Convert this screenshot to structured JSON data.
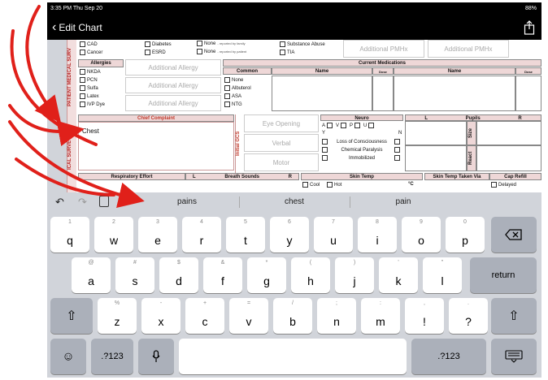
{
  "status": {
    "time_date": "3:35 PM  Thu Sep 20",
    "battery": "88%"
  },
  "nav": {
    "back_label": "Edit Chart"
  },
  "form": {
    "section_patient_history": "PATIENT MEDICAL SURV",
    "section_survey": "ICAL SURVEY",
    "pmh_col1": [
      "CAD",
      "Cancer"
    ],
    "pmh_col2": [
      "Diabetes",
      "ESRD"
    ],
    "pmh_col3": [
      "None",
      "None"
    ],
    "pmh_col3_notes": [
      "- reported by family",
      "- reported by patient"
    ],
    "pmh_col4": [
      "Substance Abuse",
      "TIA"
    ],
    "additional_pmhx": "Additional PMHx",
    "allergies_header": "Allergies",
    "allergies": [
      "NKDA",
      "PCN",
      "Sulfa",
      "Latex",
      "IVP Dye"
    ],
    "additional_allergy": "Additional Allergy",
    "current_meds_header": "Current Medications",
    "common_header": "Common",
    "common_meds": [
      "None",
      "Albuterol",
      "ASA",
      "NTG"
    ],
    "name_header": "Name",
    "dose_header": "Dose",
    "chief_complaint_header": "Chief Complaint",
    "chief_complaint_value": "Chest",
    "initial_gcs": "Initial GCS",
    "gcs_eye": "Eye Opening",
    "gcs_verbal": "Verbal",
    "gcs_motor": "Motor",
    "neuro_header": "Neuro",
    "avpu": [
      "A",
      "V",
      "P",
      "U"
    ],
    "neuro_y": "Y",
    "neuro_n": "N",
    "neuro_items": [
      "Loss of Consciousness",
      "Chemical Paralysis",
      "Immobilized"
    ],
    "pupils_l": "L",
    "pupils_header": "Pupils",
    "pupils_r": "R",
    "size_label": "Size",
    "react_label": "React",
    "resp_header": "Respiratory Effort",
    "breath_l": "L",
    "breath_header": "Breath Sounds",
    "breath_r": "R",
    "skin_temp_header": "Skin Temp",
    "skin_cool": "Cool",
    "skin_hot": "Hot",
    "celsius": "°C",
    "skin_via_header": "Skin Temp Taken Via",
    "cap_refill_header": "Cap Refill",
    "cap_delayed": "Delayed"
  },
  "predictions": [
    "pains",
    "chest",
    "pain"
  ],
  "keyboard": {
    "row1": [
      {
        "main": "q",
        "alt": "1"
      },
      {
        "main": "w",
        "alt": "2"
      },
      {
        "main": "e",
        "alt": "3"
      },
      {
        "main": "r",
        "alt": "4"
      },
      {
        "main": "t",
        "alt": "5"
      },
      {
        "main": "y",
        "alt": "6"
      },
      {
        "main": "u",
        "alt": "7"
      },
      {
        "main": "i",
        "alt": "8"
      },
      {
        "main": "o",
        "alt": "9"
      },
      {
        "main": "p",
        "alt": "0"
      }
    ],
    "row2": [
      {
        "main": "a",
        "alt": "@"
      },
      {
        "main": "s",
        "alt": "#"
      },
      {
        "main": "d",
        "alt": "$"
      },
      {
        "main": "f",
        "alt": "&"
      },
      {
        "main": "g",
        "alt": "*"
      },
      {
        "main": "h",
        "alt": "("
      },
      {
        "main": "j",
        "alt": ")"
      },
      {
        "main": "k",
        "alt": "'"
      },
      {
        "main": "l",
        "alt": "\""
      }
    ],
    "row3": [
      {
        "main": "z",
        "alt": "%"
      },
      {
        "main": "x",
        "alt": "-"
      },
      {
        "main": "c",
        "alt": "+"
      },
      {
        "main": "v",
        "alt": "="
      },
      {
        "main": "b",
        "alt": "/"
      },
      {
        "main": "n",
        "alt": ";"
      },
      {
        "main": "m",
        "alt": ":"
      },
      {
        "main": "!",
        "alt": ","
      },
      {
        "main": "?",
        "alt": "."
      }
    ],
    "return_label": "return",
    "numbers_label": ".?123",
    "numbers_label_right": ".?123"
  }
}
